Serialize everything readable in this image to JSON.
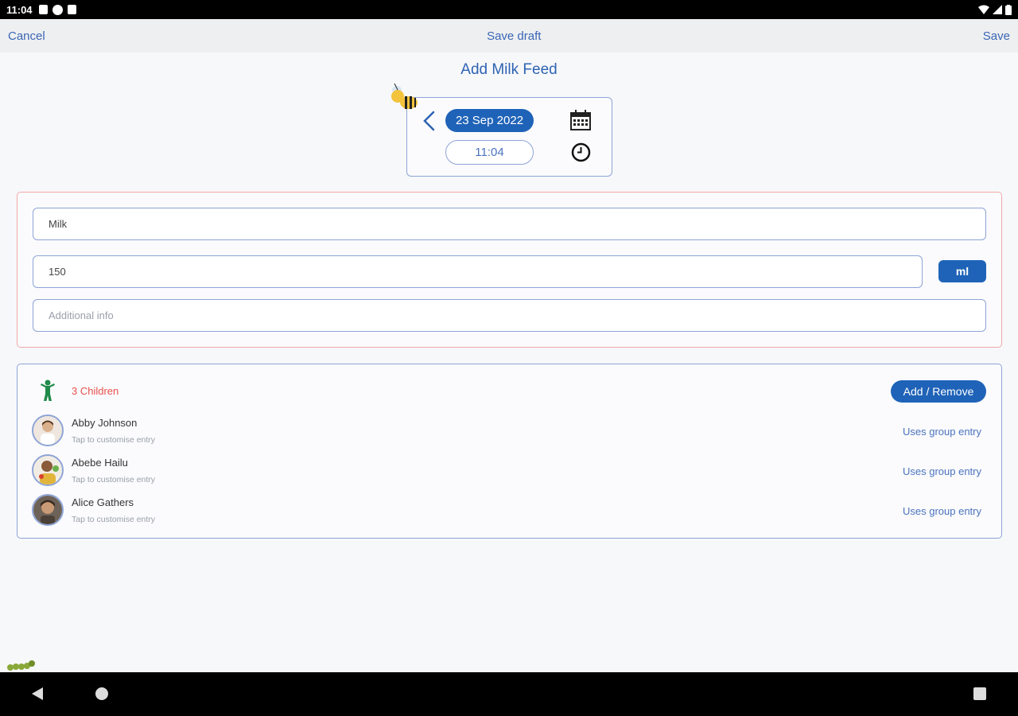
{
  "status_bar": {
    "time": "11:04"
  },
  "topbar": {
    "cancel": "Cancel",
    "save_draft": "Save draft",
    "save": "Save"
  },
  "page_title": "Add Milk Feed",
  "datetime": {
    "date": "23 Sep 2022",
    "time": "11:04"
  },
  "feed": {
    "type_value": "Milk",
    "amount_value": "150",
    "unit": "ml",
    "additional_placeholder": "Additional info"
  },
  "children": {
    "count_label": "3 Children",
    "add_remove": "Add / Remove",
    "items": [
      {
        "name": "Abby Johnson",
        "sub": "Tap to customise entry",
        "status": "Uses group entry"
      },
      {
        "name": "Abebe Hailu",
        "sub": "Tap to customise entry",
        "status": "Uses group entry"
      },
      {
        "name": "Alice Gathers",
        "sub": "Tap to customise entry",
        "status": "Uses group entry"
      }
    ]
  },
  "colors": {
    "primary": "#1f63b8",
    "accent_red": "#e8504a",
    "border": "#8da4d6"
  },
  "icons": [
    "bee-icon",
    "chevron-left-icon",
    "calendar-icon",
    "clock-icon",
    "child-icon",
    "caterpillar-icon"
  ]
}
